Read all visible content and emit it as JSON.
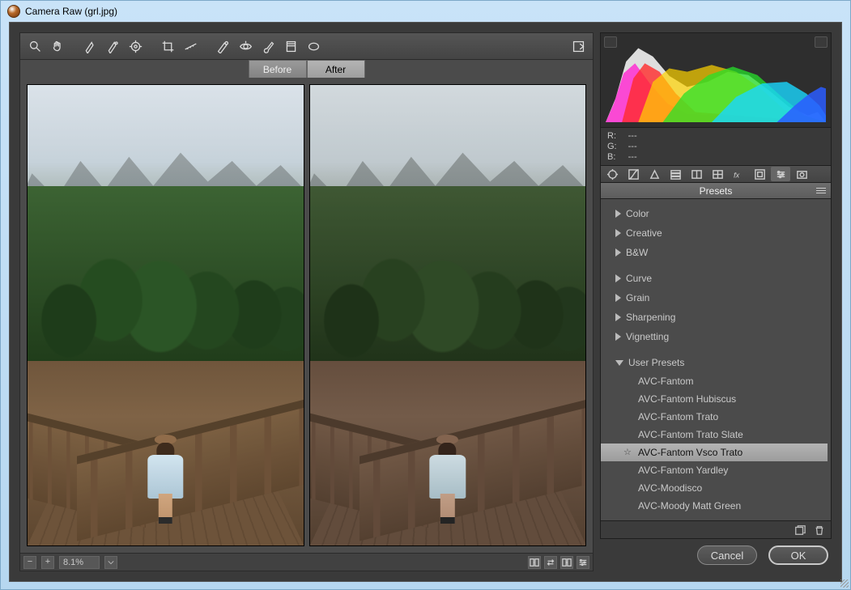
{
  "window": {
    "title": "Camera Raw (grl.jpg)"
  },
  "toolbar_icons": [
    "zoom",
    "hand",
    "white-balance",
    "color-sampler",
    "target-adjust",
    "crop",
    "straighten",
    "spot-removal",
    "red-eye",
    "adjustment-brush",
    "graduated-filter",
    "radial-filter",
    "rotate-left"
  ],
  "toolbar_right_icon": "open-preferences",
  "compare": {
    "before": "Before",
    "after": "After"
  },
  "zoom": {
    "value": "8.1%"
  },
  "readout": {
    "labels": [
      "R:",
      "G:",
      "B:"
    ],
    "values": [
      "---",
      "---",
      "---"
    ]
  },
  "mode_icons": [
    "basic",
    "tone-curve",
    "detail",
    "hsl",
    "split-tone",
    "lens",
    "fx",
    "calibration",
    "presets",
    "snapshots"
  ],
  "mode_selected_index": 8,
  "panel": {
    "title": "Presets"
  },
  "preset_groups": [
    {
      "label": "Color",
      "open": false
    },
    {
      "label": "Creative",
      "open": false
    },
    {
      "label": "B&W",
      "open": false
    },
    {
      "label": "Curve",
      "open": false
    },
    {
      "label": "Grain",
      "open": false
    },
    {
      "label": "Sharpening",
      "open": false
    },
    {
      "label": "Vignetting",
      "open": false
    }
  ],
  "user_group_label": "User Presets",
  "user_presets": [
    "AVC-Fantom",
    "AVC-Fantom Hubiscus",
    "AVC-Fantom Trato",
    "AVC-Fantom Trato Slate",
    "AVC-Fantom Vsco Trato",
    "AVC-Fantom Yardley",
    "AVC-Moodisco",
    "AVC-Moody Matt Green"
  ],
  "user_preset_selected_index": 4,
  "buttons": {
    "cancel": "Cancel",
    "ok": "OK"
  }
}
